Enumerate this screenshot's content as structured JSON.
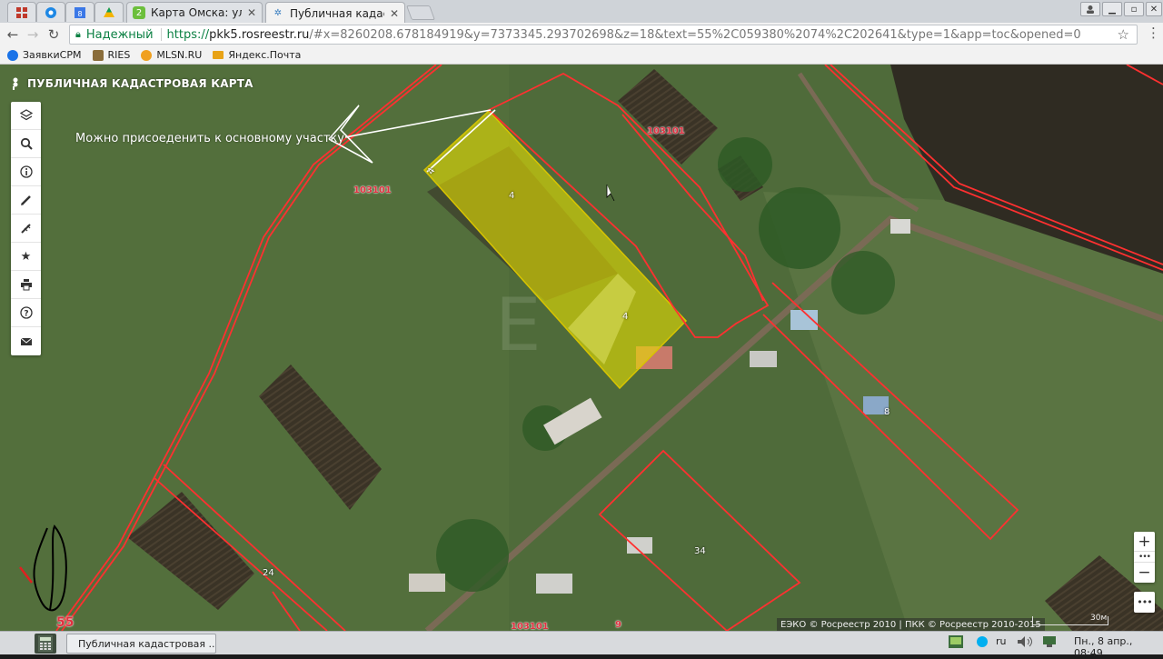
{
  "browser": {
    "tabs": [
      {
        "label": "Карта Омска: улицы",
        "icon": "2gis-icon",
        "active": false
      },
      {
        "label": "Публичная кадастро",
        "icon": "rosreestr-icon",
        "active": true
      }
    ],
    "secure_label": "Надежный",
    "url_https": "https://",
    "url_host": "pkk5.rosreestr.ru",
    "url_rest": "/#x=8260208.678184919&y=7373345.293702698&z=18&text=55%2C059380%2074%2C202641&type=1&app=toc&opened=0",
    "bookmarks": [
      {
        "label": "ЗаявкиCPM",
        "icon": "cpm-icon",
        "color": "#1a73e8"
      },
      {
        "label": "RIES",
        "icon": "ries-icon",
        "color": "#8a6d3b"
      },
      {
        "label": "MLSN.RU",
        "icon": "mlsn-icon",
        "color": "#f0a020"
      },
      {
        "label": "Яндекс.Почта",
        "icon": "mail-icon",
        "color": "#e8a317"
      }
    ]
  },
  "map": {
    "title": "ПУБЛИЧНАЯ КАДАСТРОВАЯ КАРТА",
    "sidebar": [
      {
        "name": "layers",
        "icon": "layers-icon"
      },
      {
        "name": "search",
        "icon": "search-icon"
      },
      {
        "name": "info",
        "icon": "info-icon"
      },
      {
        "name": "draw",
        "icon": "pencil-icon"
      },
      {
        "name": "measure",
        "icon": "measure-icon"
      },
      {
        "name": "favorites",
        "icon": "star-icon"
      },
      {
        "name": "print",
        "icon": "print-icon"
      },
      {
        "name": "help",
        "icon": "help-icon"
      },
      {
        "name": "feedback",
        "icon": "mail-icon"
      }
    ],
    "annotation": "Можно присоеденить к основному участку",
    "quarter_labels": [
      "103101",
      "103101",
      "103101"
    ],
    "parcel_labels": [
      "4",
      "4",
      "4",
      "8",
      "24",
      "34",
      "9",
      "55"
    ],
    "zoom": {
      "in": "+",
      "dots": "•••",
      "out": "−",
      "more": "•••"
    },
    "attribution": "ЕЭКО © Росреестр 2010 | ПКК © Росреестр 2010-2015",
    "scale_label": "30м",
    "watermark": "Е"
  },
  "taskbar": {
    "task_label": "Публичная кадастровая ...",
    "lang": "ru",
    "clock": "Пн., 8 апр., 08:49"
  },
  "colors": {
    "selected_parcel": "#e8e000",
    "boundary": "#e02020",
    "secure": "#0b8043"
  }
}
